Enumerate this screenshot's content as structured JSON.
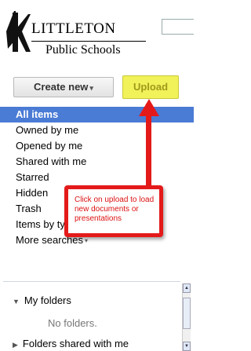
{
  "logo": {
    "line1": "LITTLETON",
    "line2": "Public Schools"
  },
  "toolbar": {
    "create_label": "Create new",
    "create_caret": "▾",
    "upload_label": "Upload"
  },
  "nav": {
    "items": [
      {
        "label": "All items",
        "active": true
      },
      {
        "label": "Owned by me"
      },
      {
        "label": "Opened by me"
      },
      {
        "label": "Shared with me"
      },
      {
        "label": "Starred"
      },
      {
        "label": "Hidden"
      },
      {
        "label": "Trash"
      },
      {
        "label": "Items by type",
        "caret": "▾"
      },
      {
        "label": "More searches",
        "caret": "▾"
      }
    ]
  },
  "folders": {
    "my_folders_label": "My folders",
    "empty_text": "No folders.",
    "shared_label": "Folders shared with me"
  },
  "annotation": {
    "text": "Click on upload to load new documents or presentations"
  },
  "colors": {
    "accent": "#4a7bd5",
    "upload": "#f1f15a",
    "annotation": "#e41a1a"
  }
}
